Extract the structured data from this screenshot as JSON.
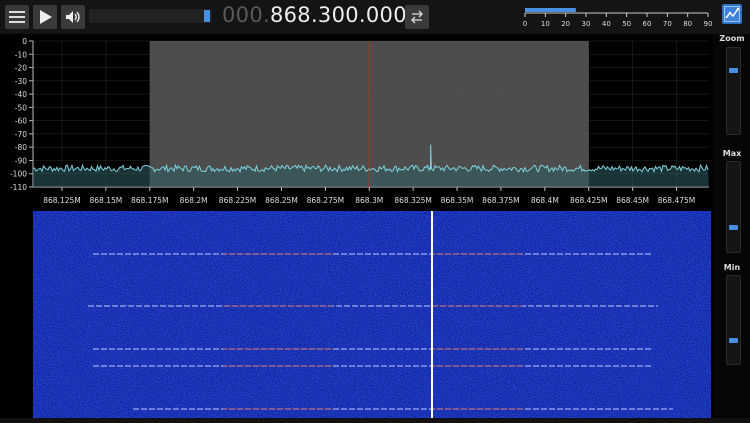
{
  "toolbar": {
    "menu_icon": "hamburger-menu-icon",
    "play_icon": "play-icon",
    "volume_icon": "speaker-icon",
    "frequency_dim": "000.",
    "frequency_main": "868.300.000",
    "tuning_mode_icon": "swap-arrows-icon",
    "settings_icon": "settings-map-icon",
    "volume_level": 1.0
  },
  "fps_scale": {
    "ticks": [
      "0",
      "10",
      "20",
      "30",
      "40",
      "50",
      "60",
      "70",
      "80",
      "90"
    ],
    "value": 25
  },
  "spectrum": {
    "y_ticks": [
      "0",
      "-10",
      "-20",
      "-30",
      "-40",
      "-50",
      "-60",
      "-70",
      "-80",
      "-90",
      "-100",
      "-110"
    ],
    "x_ticks": [
      "868.125M",
      "868.15M",
      "868.175M",
      "868.2M",
      "868.225M",
      "868.25M",
      "868.275M",
      "868.3M",
      "868.325M",
      "868.35M",
      "868.375M",
      "868.4M",
      "868.425M",
      "868.45M",
      "868.475M"
    ],
    "center_frequency": "868.3M",
    "passband": [
      "868.175M",
      "868.425M"
    ],
    "colors": {
      "trace": "#7fd3dc",
      "fill": "#2f5d63",
      "center_line": "#d22222",
      "passband": "#5a5a5a"
    }
  },
  "waterfall": {
    "background": "#0a1a9a",
    "signal_color": "#ffffff"
  },
  "side_controls": {
    "zoom_label": "Zoom",
    "max_label": "Max",
    "min_label": "Min",
    "zoom_level": 0.25,
    "max_level": 0.75,
    "min_level": 0.75
  }
}
